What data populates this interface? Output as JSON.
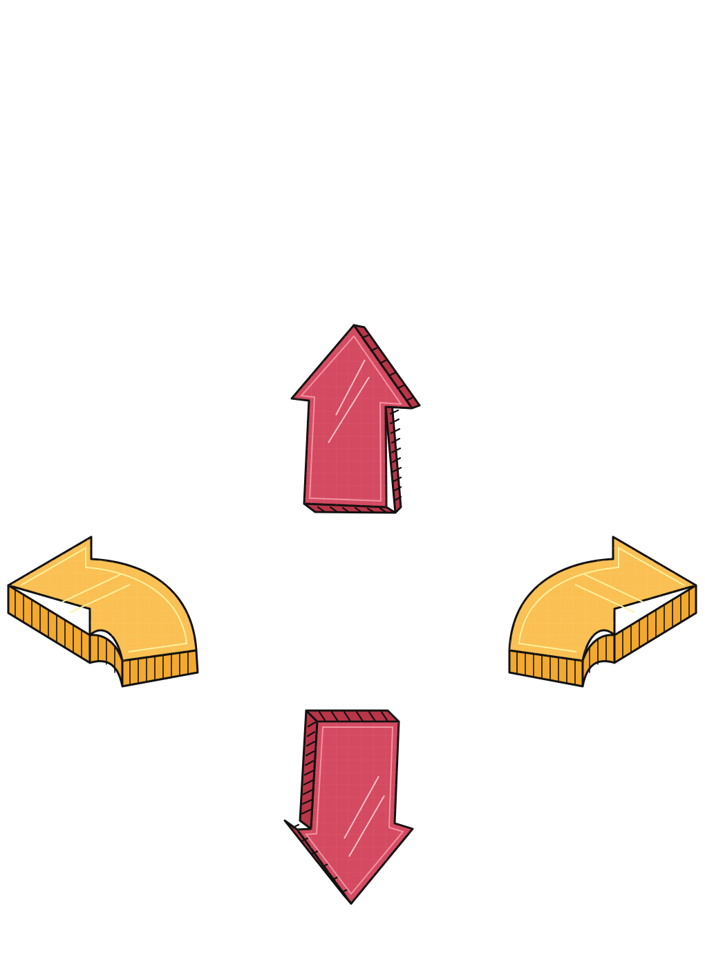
{
  "scene": {
    "background": "#ffffff",
    "arrows": [
      {
        "name": "arrow-up-icon",
        "direction": "up",
        "style": "3d-straight",
        "color": "#d44a60"
      },
      {
        "name": "arrow-down-icon",
        "direction": "down",
        "style": "3d-straight",
        "color": "#d44a60"
      },
      {
        "name": "arrow-left-curved-icon",
        "direction": "left",
        "style": "3d-curved",
        "color": "#fbc053"
      },
      {
        "name": "arrow-right-curved-icon",
        "direction": "right",
        "style": "3d-curved",
        "color": "#fbc053"
      }
    ],
    "colors": {
      "red_face": "#d44a60",
      "red_side": "#b93548",
      "red_highlight": "#f49aa8",
      "yellow_face": "#fbc053",
      "yellow_side": "#f2a92e",
      "yellow_highlight": "#fff2a0",
      "outline": "#111111"
    }
  }
}
